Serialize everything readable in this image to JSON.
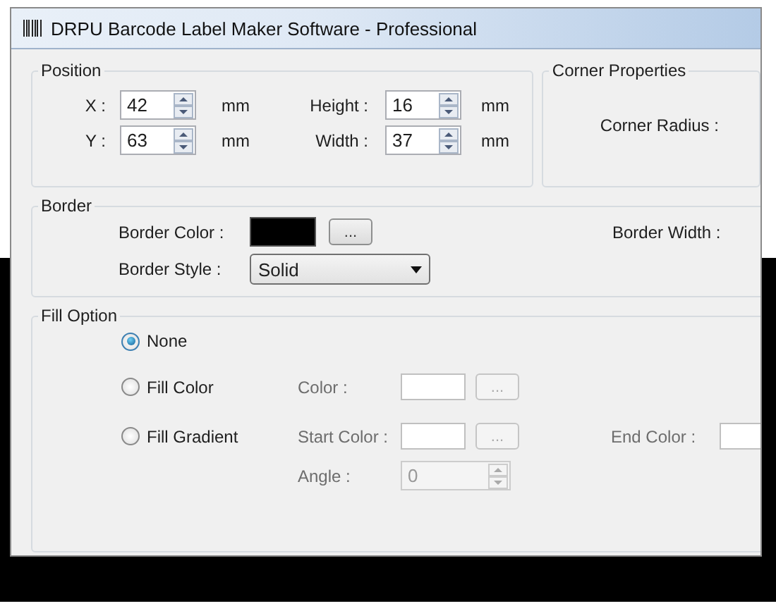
{
  "window": {
    "title": "DRPU Barcode Label Maker Software - Professional"
  },
  "position": {
    "title": "Position",
    "fields": [
      {
        "label": "X :",
        "value": "42",
        "unit": "mm"
      },
      {
        "label": "Height :",
        "value": "16",
        "unit": "mm"
      },
      {
        "label": "Y :",
        "value": "63",
        "unit": "mm"
      },
      {
        "label": "Width :",
        "value": "37",
        "unit": "mm"
      }
    ]
  },
  "corner_properties": {
    "title": "Corner Properties",
    "label": "Corner Radius :"
  },
  "border": {
    "title": "Border",
    "color_label": "Border Color :",
    "color": "#000000",
    "browse": "...",
    "style_label": "Border Style :",
    "style_value": "Solid",
    "width_label": "Border Width :"
  },
  "fill_option": {
    "title": "Fill Option",
    "options": [
      {
        "label": "None",
        "selected": true
      },
      {
        "label": "Fill Color",
        "selected": false,
        "controls": [
          {
            "kind": "color",
            "label": "Color :",
            "color": "#ffffff",
            "browse": "...",
            "disabled": true
          }
        ]
      },
      {
        "label": "Fill Gradient",
        "selected": false,
        "controls": [
          {
            "kind": "color",
            "label": "Start Color :",
            "color": "#ffffff",
            "browse": "...",
            "disabled": true
          },
          {
            "kind": "color",
            "label": "End Color :",
            "color": "#ffffff",
            "disabled": true
          },
          {
            "kind": "spin",
            "label": "Angle :",
            "value": "0",
            "disabled": true
          }
        ]
      }
    ]
  }
}
